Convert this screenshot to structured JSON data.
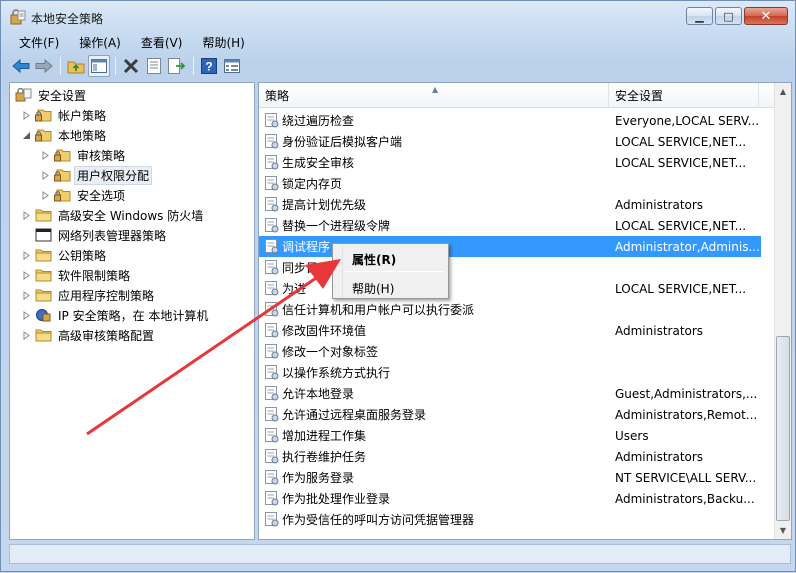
{
  "window": {
    "title": "本地安全策略",
    "controls": {
      "minimize": "▁",
      "maximize": "□",
      "close": "✕"
    }
  },
  "menu": [
    "文件(F)",
    "操作(A)",
    "查看(V)",
    "帮助(H)"
  ],
  "toolbar": [
    "back-icon",
    "forward-icon",
    "up-folder-icon",
    "show-tree-icon",
    "delete-icon",
    "properties-icon",
    "export-icon",
    "help-icon",
    "details-view-icon"
  ],
  "tree": {
    "root": "安全设置",
    "items": [
      {
        "label": "帐户策略",
        "level": 1,
        "twisty": "collapsed"
      },
      {
        "label": "本地策略",
        "level": 1,
        "twisty": "expanded"
      },
      {
        "label": "审核策略",
        "level": 2,
        "twisty": "collapsed"
      },
      {
        "label": "用户权限分配",
        "level": 2,
        "twisty": "collapsed",
        "selected": true
      },
      {
        "label": "安全选项",
        "level": 2,
        "twisty": "collapsed"
      },
      {
        "label": "高级安全 Windows 防火墙",
        "level": 1,
        "twisty": "collapsed"
      },
      {
        "label": "网络列表管理器策略",
        "level": 1,
        "twisty": "none"
      },
      {
        "label": "公钥策略",
        "level": 1,
        "twisty": "collapsed"
      },
      {
        "label": "软件限制策略",
        "level": 1,
        "twisty": "collapsed"
      },
      {
        "label": "应用程序控制策略",
        "level": 1,
        "twisty": "collapsed"
      },
      {
        "label": "IP 安全策略，在 本地计算机",
        "level": 1,
        "twisty": "collapsed"
      },
      {
        "label": "高级审核策略配置",
        "level": 1,
        "twisty": "collapsed"
      }
    ]
  },
  "list": {
    "columns": [
      "策略",
      "安全设置"
    ],
    "rows": [
      {
        "policy": "绕过遍历检查",
        "setting": "Everyone,LOCAL SERV..."
      },
      {
        "policy": "身份验证后模拟客户端",
        "setting": "LOCAL SERVICE,NET..."
      },
      {
        "policy": "生成安全审核",
        "setting": "LOCAL SERVICE,NET..."
      },
      {
        "policy": "锁定内存页",
        "setting": ""
      },
      {
        "policy": "提高计划优先级",
        "setting": "Administrators"
      },
      {
        "policy": "替换一个进程级令牌",
        "setting": "LOCAL SERVICE,NET..."
      },
      {
        "policy": "调试程序",
        "setting": "Administrator,Adminis...",
        "selected": true
      },
      {
        "policy": "同步目",
        "setting": ""
      },
      {
        "policy": "为进",
        "setting": "LOCAL SERVICE,NET..."
      },
      {
        "policy": "信任计算机和用户帐户可以执行委派",
        "setting": ""
      },
      {
        "policy": "修改固件环境值",
        "setting": "Administrators"
      },
      {
        "policy": "修改一个对象标签",
        "setting": ""
      },
      {
        "policy": "以操作系统方式执行",
        "setting": ""
      },
      {
        "policy": "允许本地登录",
        "setting": "Guest,Administrators,..."
      },
      {
        "policy": "允许通过远程桌面服务登录",
        "setting": "Administrators,Remot..."
      },
      {
        "policy": "增加进程工作集",
        "setting": "Users"
      },
      {
        "policy": "执行卷维护任务",
        "setting": "Administrators"
      },
      {
        "policy": "作为服务登录",
        "setting": "NT SERVICE\\ALL SERV..."
      },
      {
        "policy": "作为批处理作业登录",
        "setting": "Administrators,Backu..."
      },
      {
        "policy": "作为受信任的呼叫方访问凭据管理器",
        "setting": ""
      }
    ]
  },
  "context_menu": {
    "items": [
      {
        "label": "属性(R)",
        "bold": true
      },
      {
        "label": "帮助(H)",
        "bold": false
      }
    ]
  },
  "colors": {
    "selection": "#3399ff",
    "annotation_arrow": "#e8373a"
  }
}
